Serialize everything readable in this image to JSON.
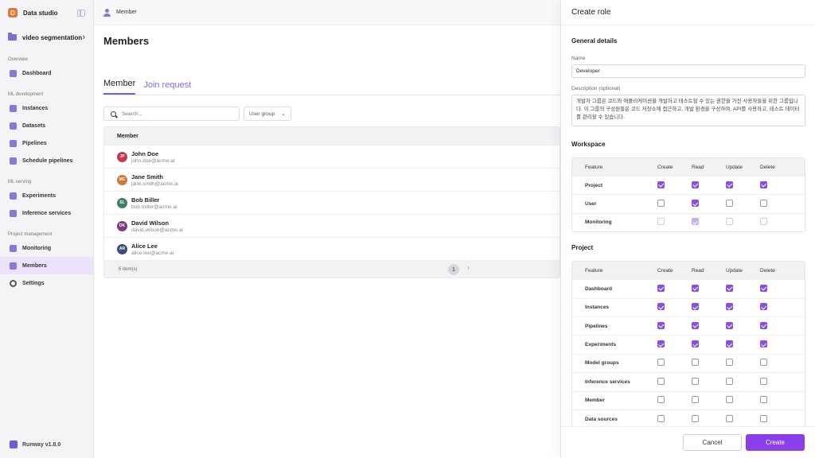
{
  "sidebar": {
    "brand_initial": "D",
    "brand_name": "Data studio",
    "project_name": "video segmentation",
    "sections": [
      {
        "label": "Overview",
        "items": [
          {
            "label": "Dashboard",
            "icon": "dashboard-icon"
          }
        ]
      },
      {
        "label": "ML development",
        "items": [
          {
            "label": "Instances",
            "icon": "instances-icon"
          },
          {
            "label": "Datasets",
            "icon": "datasets-icon"
          },
          {
            "label": "Pipelines",
            "icon": "pipelines-icon"
          },
          {
            "label": "Schedule pipelines",
            "icon": "schedule-icon"
          }
        ]
      },
      {
        "label": "ML serving",
        "items": [
          {
            "label": "Experiments",
            "icon": "experiments-icon"
          },
          {
            "label": "Inference services",
            "icon": "inference-icon"
          }
        ]
      },
      {
        "label": "Project management",
        "items": [
          {
            "label": "Monitoring",
            "icon": "monitoring-icon"
          },
          {
            "label": "Members",
            "icon": "members-icon",
            "active": true
          },
          {
            "label": "Settings",
            "icon": "gear-icon"
          }
        ]
      }
    ],
    "version": "Runway v1.8.0"
  },
  "main": {
    "breadcrumb": "Member",
    "title": "Members",
    "tabs": [
      {
        "label": "Member",
        "active": true
      },
      {
        "label": "Join request",
        "active": false
      }
    ],
    "search_placeholder": "Search...",
    "user_group_label": "User group",
    "table_header": "Member",
    "members": [
      {
        "initials": "JP",
        "name": "John Doe",
        "email": "john.doe@acme.ai",
        "color": "#c8374f"
      },
      {
        "initials": "MC",
        "name": "Jane Smith",
        "email": "jane.smith@acme.ai",
        "color": "#d0773c"
      },
      {
        "initials": "SL",
        "name": "Bob Biller",
        "email": "bob.miller@acme.ai",
        "color": "#3f7f64"
      },
      {
        "initials": "DK",
        "name": "David Wilson",
        "email": "david.wilson@acme.ai",
        "color": "#7a3f7e"
      },
      {
        "initials": "AR",
        "name": "Alice Lee",
        "email": "alice.lee@acme.ai",
        "color": "#3d4d7a"
      }
    ],
    "item_count": "5 item(s)",
    "current_page": "1"
  },
  "drawer": {
    "title": "Create role",
    "general_title": "General details",
    "name_label": "Name",
    "name_value": "Developer",
    "desc_label": "Description (optional)",
    "desc_value": "개발자 그룹은 코드와 애플리케이션을 개발하고 테스트할 수 있는 권한을 가진 사용자들을 위한 그룹입니다. 이 그룹의 구성원들은 코드 저장소에 접근하고, 개발 환경을 구성하며, API를 사용하고, 테스트 데이터를 관리할 수 있습니다.",
    "columns": [
      "Feature",
      "Create",
      "Read",
      "Update",
      "Delete"
    ],
    "workspace_title": "Workspace",
    "workspace_rows": [
      {
        "feature": "Project",
        "perms": [
          true,
          true,
          true,
          true
        ],
        "disabled": false
      },
      {
        "feature": "User",
        "perms": [
          false,
          true,
          false,
          false
        ],
        "disabled": false
      },
      {
        "feature": "Monitoring",
        "perms": [
          false,
          true,
          false,
          false
        ],
        "disabled": true
      }
    ],
    "project_title": "Project",
    "project_rows": [
      {
        "feature": "Dashboard",
        "perms": [
          true,
          true,
          true,
          true
        ]
      },
      {
        "feature": "Instances",
        "perms": [
          true,
          true,
          true,
          true
        ]
      },
      {
        "feature": "Pipelines",
        "perms": [
          true,
          true,
          true,
          true
        ]
      },
      {
        "feature": "Experiments",
        "perms": [
          true,
          true,
          true,
          true
        ]
      },
      {
        "feature": "Model groups",
        "perms": [
          false,
          false,
          false,
          false
        ]
      },
      {
        "feature": "Inference services",
        "perms": [
          false,
          false,
          false,
          false
        ]
      },
      {
        "feature": "Member",
        "perms": [
          false,
          false,
          false,
          false
        ]
      },
      {
        "feature": "Data sources",
        "perms": [
          false,
          false,
          false,
          false
        ]
      }
    ],
    "cancel_label": "Cancel",
    "create_label": "Create"
  }
}
